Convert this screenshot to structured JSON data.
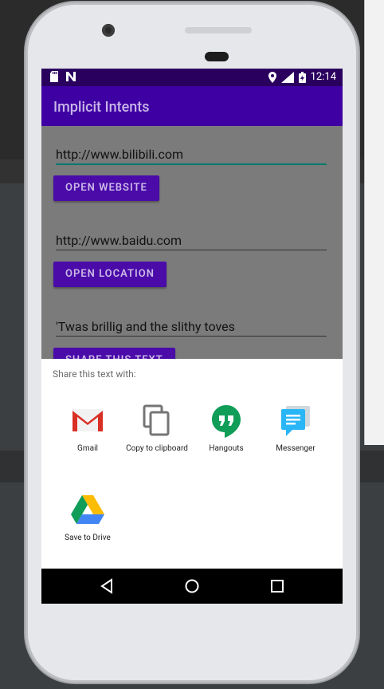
{
  "statusbar": {
    "time": "12:14",
    "icons": [
      "sdcard-icon",
      "n-icon",
      "location-icon",
      "signal-icon",
      "battery-icon"
    ]
  },
  "app": {
    "title": "Implicit Intents",
    "website_field": "http://www.bilibili.com",
    "open_website_label": "OPEN WEBSITE",
    "location_field": "http://www.baidu.com",
    "open_location_label": "OPEN LOCATION",
    "share_field": "'Twas brillig and the slithy toves",
    "share_button_label": "SHARE THIS TEXT"
  },
  "share_sheet": {
    "title": "Share this text with:",
    "apps": [
      {
        "label": "Gmail",
        "icon": "gmail-icon"
      },
      {
        "label": "Copy to clipboard",
        "icon": "copy-icon"
      },
      {
        "label": "Hangouts",
        "icon": "hangouts-icon"
      },
      {
        "label": "Messenger",
        "icon": "messenger-icon"
      },
      {
        "label": "Save to Drive",
        "icon": "drive-icon"
      }
    ]
  },
  "navbar": {
    "buttons": [
      "back-icon",
      "home-icon",
      "recents-icon"
    ]
  },
  "colors": {
    "status": "#2a005f",
    "appbar": "#3f00a3",
    "button": "#4a0ba9",
    "accent": "#00796b"
  }
}
